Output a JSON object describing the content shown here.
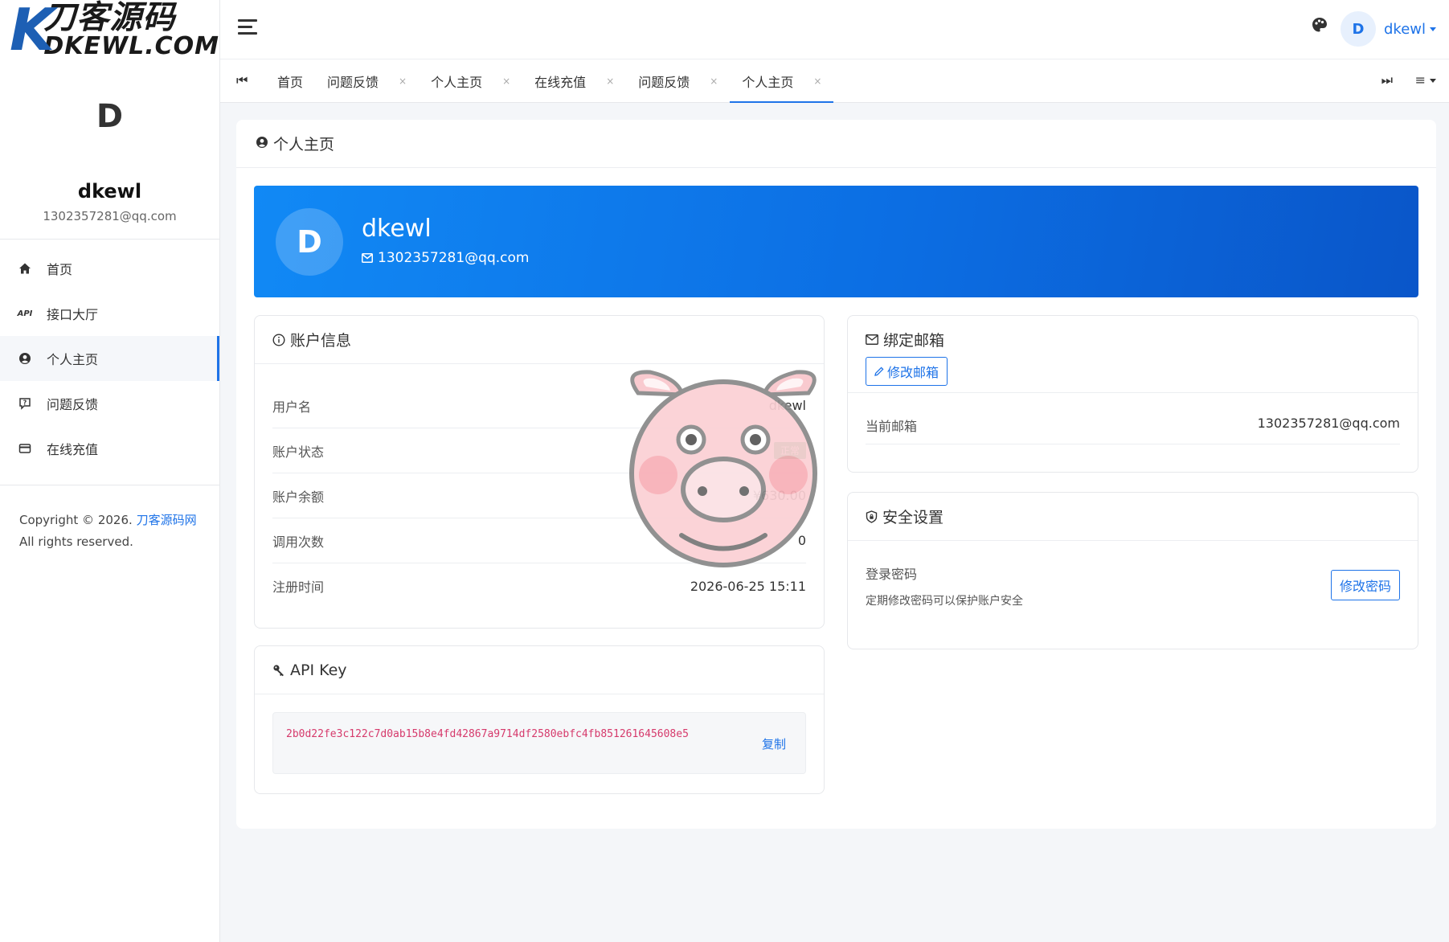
{
  "brand": {
    "logo_cn": "刀客源码",
    "logo_en": "DKEWL.COM",
    "logo_mark": "K"
  },
  "sidebar": {
    "initial": "D",
    "name": "dkewl",
    "email": "1302357281@qq.com",
    "items": [
      {
        "label": "首页",
        "icon": "home-icon"
      },
      {
        "label": "接口大厅",
        "icon": "api-icon",
        "icon_text": "API"
      },
      {
        "label": "个人主页",
        "icon": "user-circle-icon",
        "active": true
      },
      {
        "label": "问题反馈",
        "icon": "feedback-icon"
      },
      {
        "label": "在线充值",
        "icon": "card-icon"
      }
    ],
    "copyright_prefix": "Copyright © 2026.",
    "copyright_link": "刀客源码网",
    "copyright_suffix": "All rights reserved."
  },
  "header": {
    "avatar_initial": "D",
    "username": "dkewl"
  },
  "tabs": [
    {
      "label": "首页",
      "closable": false
    },
    {
      "label": "问题反馈",
      "closable": true
    },
    {
      "label": "个人主页",
      "closable": true
    },
    {
      "label": "在线充值",
      "closable": true
    },
    {
      "label": "问题反馈",
      "closable": true
    },
    {
      "label": "个人主页",
      "closable": true,
      "active": true
    }
  ],
  "tab_close_glyph": "×",
  "page": {
    "title": "个人主页"
  },
  "hero": {
    "initial": "D",
    "name": "dkewl",
    "email": "1302357281@qq.com"
  },
  "account": {
    "title": "账户信息",
    "rows": [
      {
        "label": "用户名",
        "value": "dkewl"
      },
      {
        "label": "账户状态",
        "value": "正常"
      },
      {
        "label": "账户余额",
        "value": "¥630.00"
      },
      {
        "label": "调用次数",
        "value": "0"
      },
      {
        "label": "注册时间",
        "value": "2026-06-25 15:11"
      }
    ]
  },
  "apikey": {
    "title": "API Key",
    "key": "2b0d22fe3c122c7d0ab15b8e4fd42867a9714df2580ebfc4fb851261645608e5",
    "copy_label": "复制"
  },
  "email_card": {
    "title": "绑定邮箱",
    "edit_label": "修改邮箱",
    "current_label": "当前邮箱",
    "current_value": "1302357281@qq.com"
  },
  "security": {
    "title": "安全设置",
    "password_label": "登录密码",
    "password_desc": "定期修改密码可以保护账户安全",
    "change_label": "修改密码"
  },
  "colors": {
    "accent": "#1e73e8",
    "hero_start": "#1189f5",
    "hero_end": "#0a56c9",
    "badge": "#34b36b",
    "key_text": "#d63a6c"
  }
}
